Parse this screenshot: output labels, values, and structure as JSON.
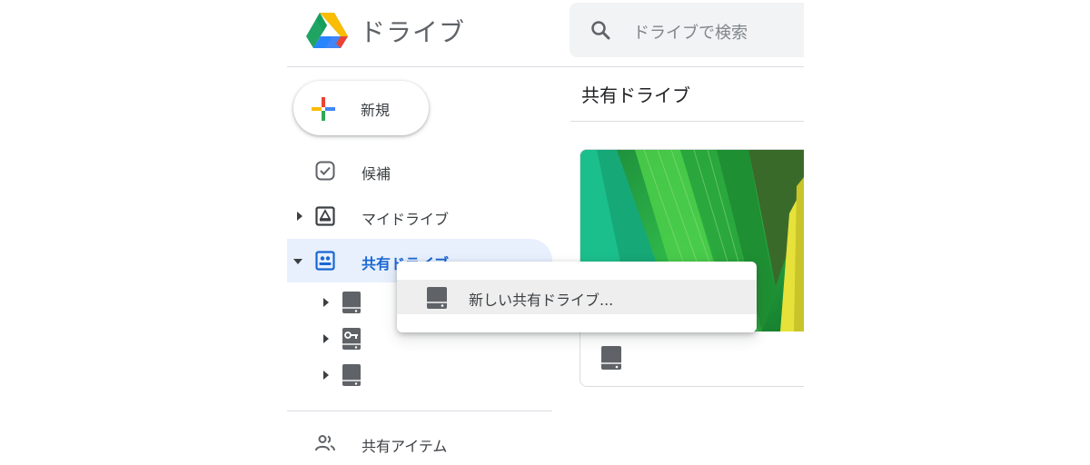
{
  "header": {
    "app_title": "ドライブ",
    "search": {
      "placeholder": "ドライブで検索",
      "icon": "search-icon"
    },
    "logo": "google-drive-logo"
  },
  "new_button": {
    "label": "新規",
    "icon": "multicolor-plus-icon"
  },
  "sidebar": {
    "items": [
      {
        "label": "候補",
        "icon": "checkbox-icon",
        "expandable": false
      },
      {
        "label": "マイドライブ",
        "icon": "my-drive-icon",
        "expandable": true,
        "expanded": false
      },
      {
        "label": "共有ドライブ",
        "icon": "shared-drives-icon",
        "expandable": true,
        "expanded": true,
        "selected": true
      },
      {
        "label": "共有アイテム",
        "icon": "people-icon",
        "expandable": false
      }
    ],
    "shared_drive_children": [
      {
        "icon": "drive-icon"
      },
      {
        "icon": "drive-key-icon"
      },
      {
        "icon": "drive-icon"
      }
    ]
  },
  "main": {
    "section_title": "共有ドライブ",
    "card": {
      "icon": "drive-icon"
    }
  },
  "context_menu": {
    "items": [
      {
        "label": "新しい共有ドライブ...",
        "icon": "drive-icon",
        "highlighted": true
      }
    ]
  },
  "colors": {
    "selected_background": "#e8f0fe",
    "selected_text": "#1967d2",
    "menu_highlight": "#eeeeee",
    "icon_gray": "#5f6368"
  }
}
